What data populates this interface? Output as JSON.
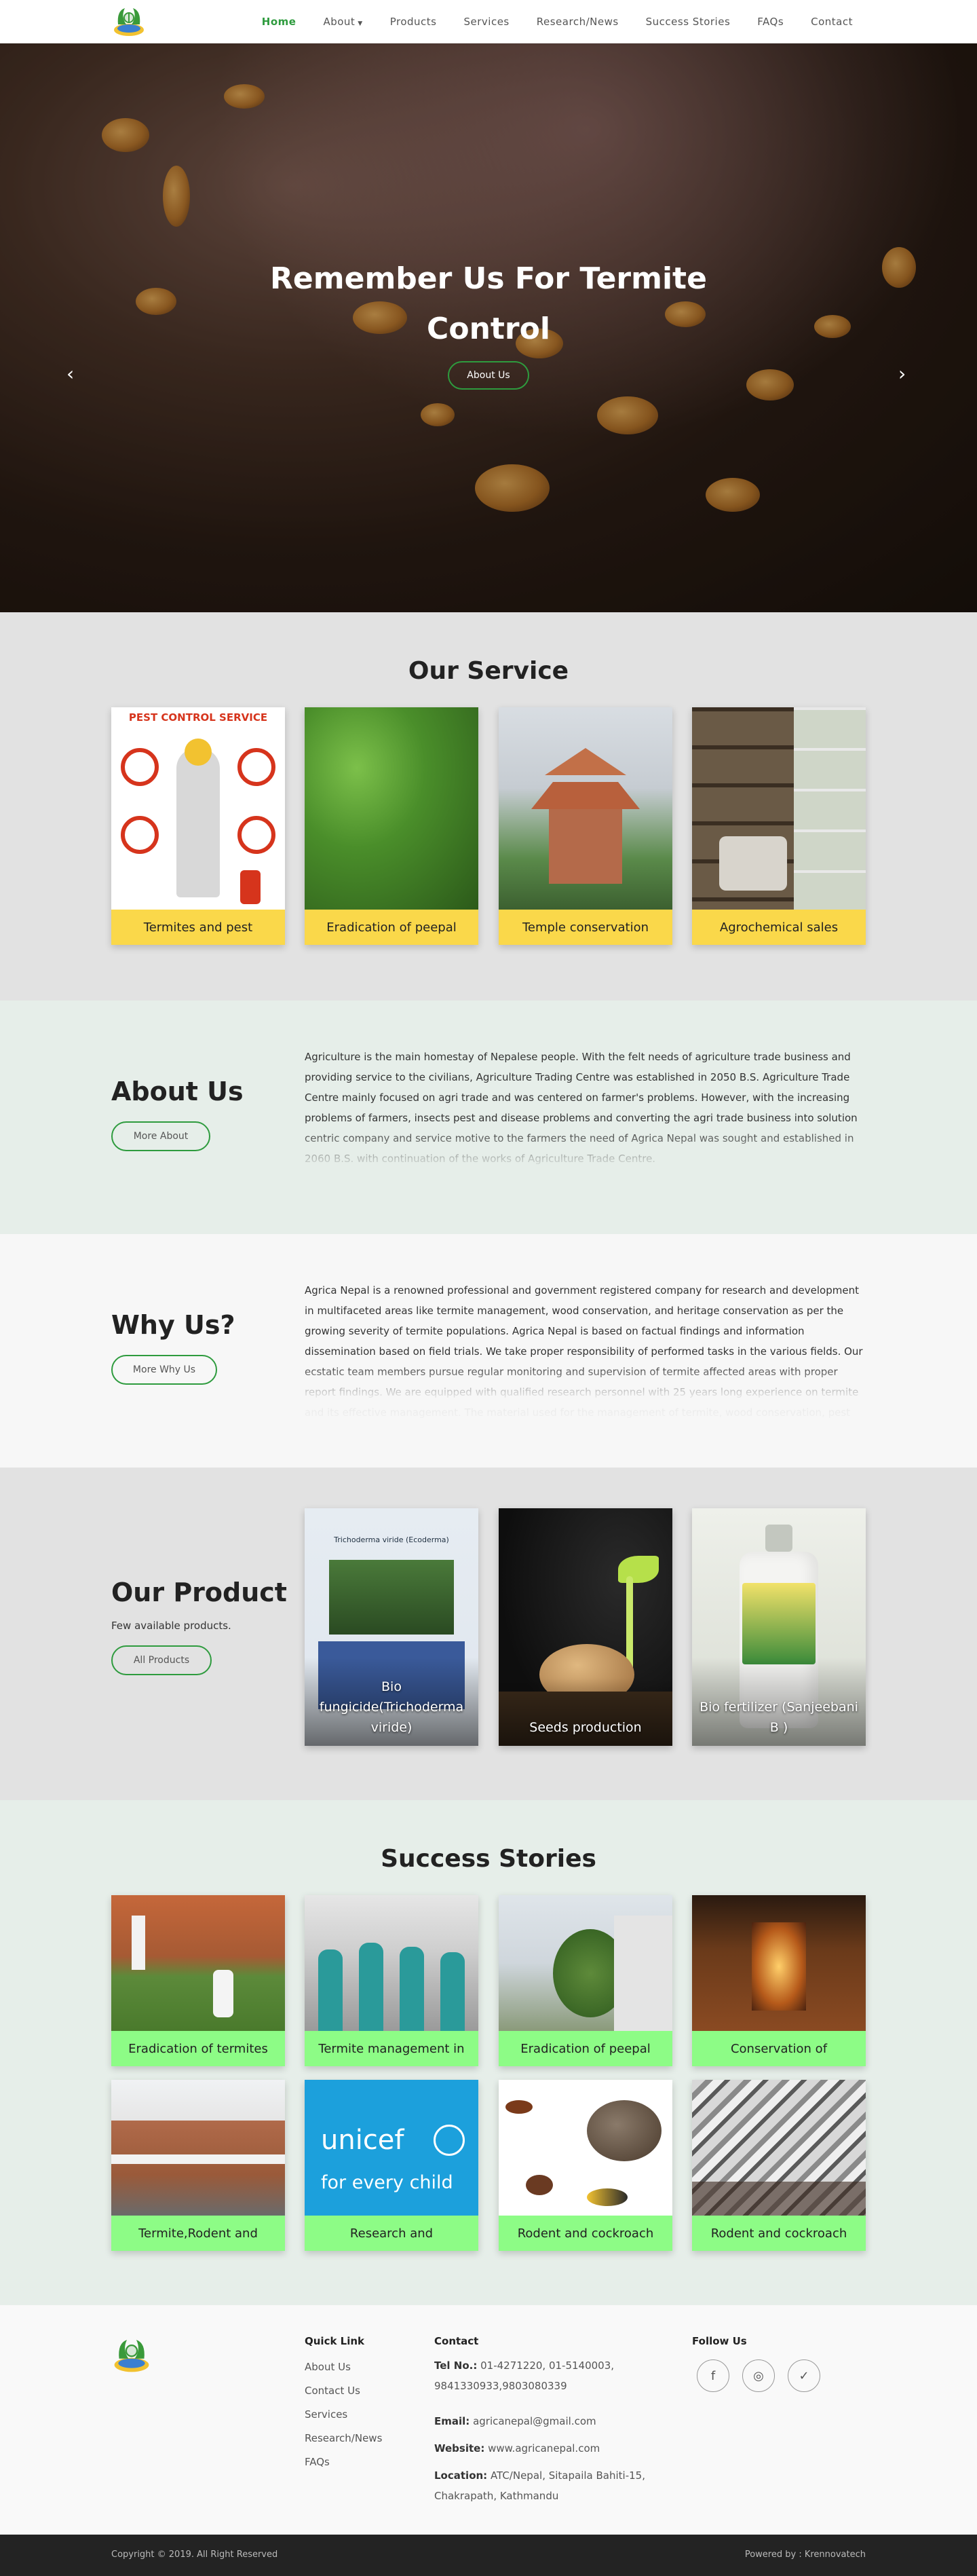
{
  "nav": {
    "items": [
      {
        "label": "Home",
        "active": true
      },
      {
        "label": "About",
        "dropdown": true
      },
      {
        "label": "Products"
      },
      {
        "label": "Services"
      },
      {
        "label": "Research/News"
      },
      {
        "label": "Success Stories"
      },
      {
        "label": "FAQs"
      },
      {
        "label": "Contact"
      }
    ]
  },
  "hero": {
    "title_line1": "Remember Us For Termite",
    "title_line2": "Control",
    "button": "About Us",
    "prev_icon": "‹",
    "next_icon": "›"
  },
  "service": {
    "title": "Our Service",
    "cards": [
      {
        "caption": "Termites and pest",
        "image_text": "PEST CONTROL SERVICE"
      },
      {
        "caption": "Eradication of peepal"
      },
      {
        "caption": "Temple conservation"
      },
      {
        "caption": "Agrochemical sales"
      }
    ]
  },
  "about": {
    "title": "About Us",
    "button": "More About",
    "text": "Agriculture is the main homestay of Nepalese people. With the felt needs of agriculture trade business and providing service to the civilians, Agriculture Trading Centre was established in 2050 B.S. Agriculture Trade Centre mainly focused on agri trade and was centered on farmer's problems. However, with the increasing problems of farmers, insects pest and disease problems and converting the agri trade business into solution centric company and service motive to the farmers the need of Agrica Nepal was sought and established in 2060 B.S. with continuation of the works of Agriculture Trade Centre."
  },
  "why": {
    "title": "Why Us?",
    "button": "More Why Us",
    "text": "Agrica Nepal is a renowned professional and government registered company for research and development in multifaceted areas like termite management, wood conservation, and heritage conservation as per the growing severity of termite populations. Agrica Nepal is based on factual findings and information dissemination based on field trials. We take proper responsibility of performed tasks in the various fields. Our ecstatic team members pursue regular monitoring and supervision of termite affected areas with proper report findings. We are equipped with qualified research personnel with 25 years long experience on termite and its effective management. The material used for the management of termite, wood conservation, pest"
  },
  "products": {
    "title": "Our Product",
    "subtitle": "Few available products.",
    "button": "All Products",
    "cards": [
      {
        "caption": "Bio fungicide(Trichoderma viride)",
        "image_text": "Trichoderma viride (Ecoderma)"
      },
      {
        "caption": "Seeds production"
      },
      {
        "caption": "Bio fertilizer (Sanjeebani B )"
      }
    ]
  },
  "success": {
    "title": "Success Stories",
    "cards": [
      {
        "caption": "Eradication of termites"
      },
      {
        "caption": "Termite management in"
      },
      {
        "caption": "Eradication of peepal"
      },
      {
        "caption": "Conservation of"
      },
      {
        "caption": "Termite,Rodent and"
      },
      {
        "caption": "Research and",
        "image_text": "unicef",
        "image_subtext": "for every child"
      },
      {
        "caption": "Rodent and cockroach"
      },
      {
        "caption": "Rodent and cockroach"
      }
    ]
  },
  "footer": {
    "quick_title": "Quick Link",
    "quick_links": [
      "About Us",
      "Contact Us",
      "Services",
      "Research/News",
      "FAQs"
    ],
    "contact_title": "Contact",
    "tel_label": "Tel No.:",
    "tel": "01-4271220, 01-5140003, 9841330933,9803080339",
    "email_label": "Email:",
    "email": "agricanepal@gmail.com",
    "website_label": "Website:",
    "website": "www.agricanepal.com",
    "location_label": "Location:",
    "location": "ATC/Nepal, Sitapaila Bahiti-15, Chakrapath, Kathmandu",
    "follow_title": "Follow Us",
    "social": [
      {
        "icon": "facebook-icon",
        "glyph": "f"
      },
      {
        "icon": "instagram-icon",
        "glyph": "◎"
      },
      {
        "icon": "twitter-icon",
        "glyph": "✓"
      }
    ]
  },
  "bottom": {
    "copyright": "Copyright © 2019. All Right Reserved",
    "powered": "Powered by : Krennovatech"
  },
  "colors": {
    "accent": "#2e9b3e",
    "service_caption": "#fad84a",
    "success_caption": "#8dfc86"
  }
}
